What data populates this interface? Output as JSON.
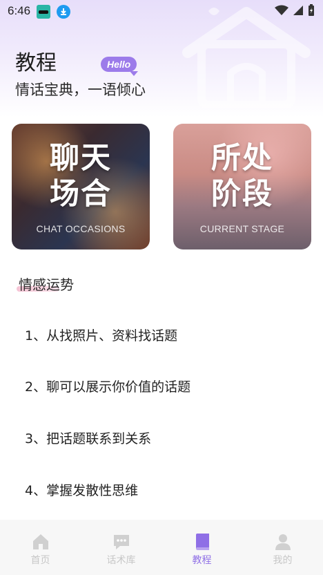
{
  "status_bar": {
    "time": "6:46"
  },
  "header": {
    "title": "教程",
    "badge": "Hello",
    "subtitle": "情话宝典，一语倾心"
  },
  "cards": [
    {
      "title_line1": "聊天",
      "title_line2": "场合",
      "subtitle": "CHAT OCCASIONS"
    },
    {
      "title_line1": "所处",
      "title_line2": "阶段",
      "subtitle": "CURRENT STAGE"
    }
  ],
  "section": {
    "title": "情感运势"
  },
  "topics": [
    "1、从找照片、资料找话题",
    "2、聊可以展示你价值的话题",
    "3、把话题联系到关系",
    "4、掌握发散性思维"
  ],
  "bottom_nav": [
    {
      "label": "首页",
      "icon": "home-icon",
      "active": false
    },
    {
      "label": "话术库",
      "icon": "chat-icon",
      "active": false
    },
    {
      "label": "教程",
      "icon": "book-icon",
      "active": true
    },
    {
      "label": "我的",
      "icon": "person-icon",
      "active": false
    }
  ],
  "colors": {
    "accent": "#8f6fe6",
    "badge": "#9c7bea",
    "inactive_nav": "#c7c7c7"
  }
}
